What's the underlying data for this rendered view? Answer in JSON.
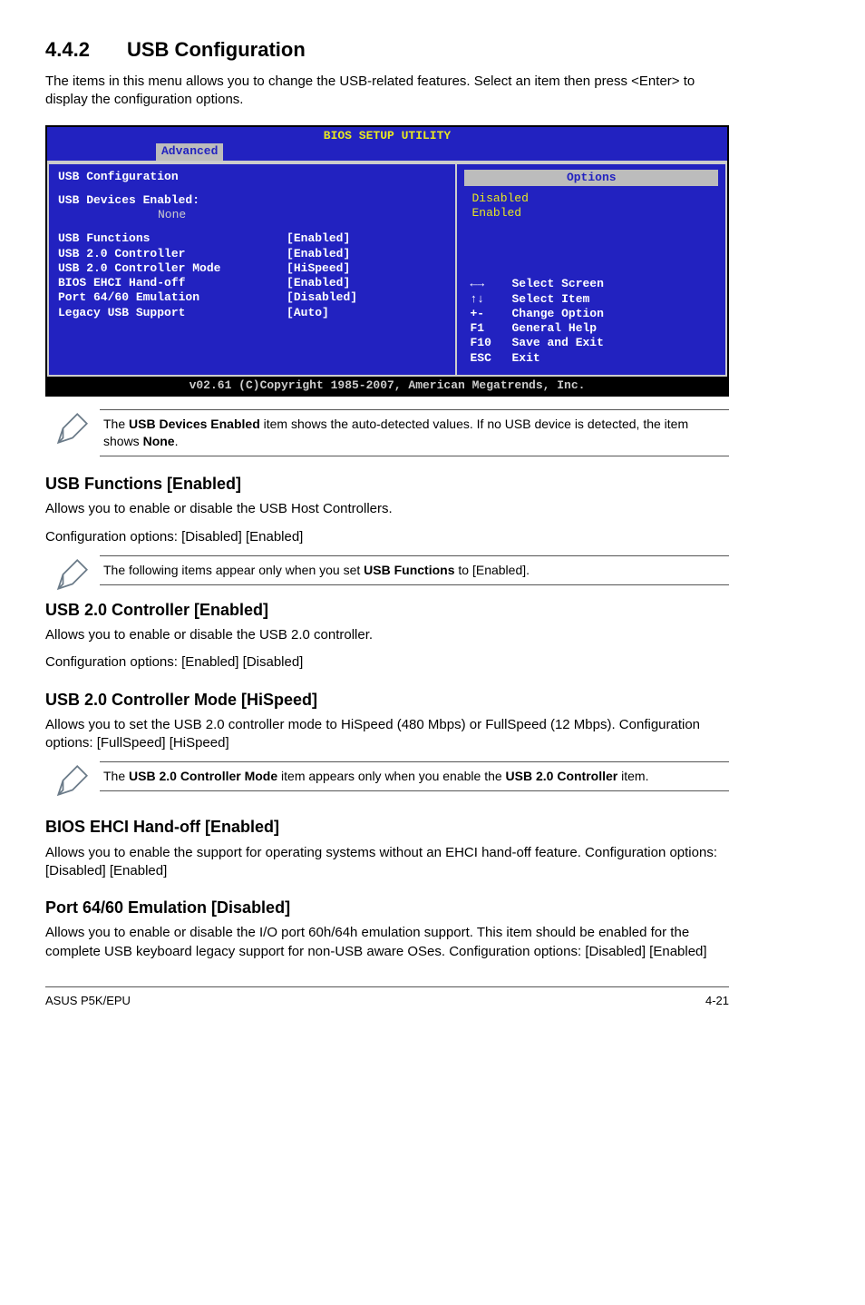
{
  "section": {
    "number": "4.4.2",
    "title": "USB Configuration"
  },
  "intro": "The items in this menu allows you to change the USB-related features. Select an item then press <Enter> to display the configuration options.",
  "bios": {
    "title": "BIOS SETUP UTILITY",
    "tab": "Advanced",
    "panel_title": "USB Configuration",
    "devices_label": "USB Devices Enabled:",
    "devices_value": "None",
    "rows": [
      {
        "k": "USB Functions",
        "v": "[Enabled]"
      },
      {
        "k": "USB 2.0 Controller",
        "v": "[Enabled]"
      },
      {
        "k": "USB 2.0 Controller Mode",
        "v": "[HiSpeed]"
      },
      {
        "k": "BIOS EHCI Hand-off",
        "v": "[Enabled]"
      },
      {
        "k": "Port 64/60 Emulation",
        "v": "[Disabled]"
      },
      {
        "k": "Legacy USB Support",
        "v": "[Auto]"
      }
    ],
    "options_header": "Options",
    "options": [
      "Disabled",
      "Enabled"
    ],
    "nav": [
      {
        "k": "←→",
        "t": "Select Screen"
      },
      {
        "k": "↑↓",
        "t": "Select Item"
      },
      {
        "k": "+-",
        "t": "Change Option"
      },
      {
        "k": "F1",
        "t": "General Help"
      },
      {
        "k": "F10",
        "t": "Save and Exit"
      },
      {
        "k": "ESC",
        "t": "Exit"
      }
    ],
    "footer": "v02.61 (C)Copyright 1985-2007, American Megatrends, Inc."
  },
  "note1_a": "The ",
  "note1_b": "USB Devices Enabled",
  "note1_c": " item shows the auto-detected values. If no USB device is detected, the item shows ",
  "note1_d": "None",
  "note1_e": ".",
  "h_usbfunc": "USB Functions [Enabled]",
  "p_usbfunc1": "Allows you to enable or disable the USB Host Controllers.",
  "p_usbfunc2": "Configuration options: [Disabled] [Enabled]",
  "note2_a": "The following items appear only when you set ",
  "note2_b": "USB Functions",
  "note2_c": " to [Enabled].",
  "h_usb20c": "USB 2.0 Controller [Enabled]",
  "p_usb20c1": "Allows you to enable or disable the USB 2.0 controller.",
  "p_usb20c2": "Configuration options: [Enabled] [Disabled]",
  "h_usb20m": "USB 2.0 Controller Mode [HiSpeed]",
  "p_usb20m": "Allows you to set the USB 2.0 controller mode to HiSpeed (480 Mbps) or FullSpeed (12 Mbps). Configuration options: [FullSpeed] [HiSpeed]",
  "note3_a": "The ",
  "note3_b": "USB 2.0 Controller Mode",
  "note3_c": " item appears only when you enable the ",
  "note3_d": "USB 2.0 Controller",
  "note3_e": " item.",
  "h_ehci": "BIOS EHCI Hand-off [Enabled]",
  "p_ehci": "Allows you to enable the support for operating systems without an EHCI hand-off feature. Configuration options: [Disabled] [Enabled]",
  "h_port": "Port 64/60 Emulation [Disabled]",
  "p_port": "Allows you to enable or disable the I/O port 60h/64h emulation support. This item should be enabled for the complete USB keyboard legacy support for non-USB aware OSes. Configuration options: [Disabled] [Enabled]",
  "footer_left": "ASUS P5K/EPU",
  "footer_right": "4-21"
}
